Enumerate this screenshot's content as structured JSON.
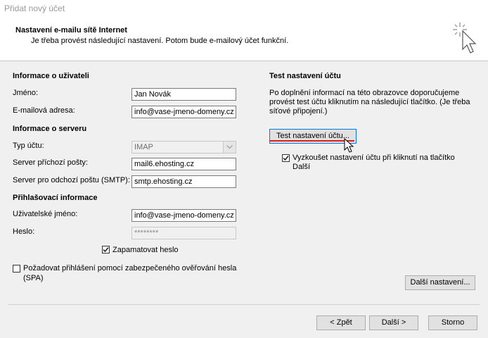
{
  "window": {
    "title": "Přidat nový účet"
  },
  "header": {
    "title": "Nastavení e-mailu sítě Internet",
    "subtitle": "Je třeba provést následující nastavení. Potom bude e-mailový účet funkční.",
    "icon": "cursor-sparkle-icon"
  },
  "user_info": {
    "section_title": "Informace o uživateli",
    "name_label": "Jméno:",
    "name_value": "Jan Novák",
    "email_label": "E-mailová adresa:",
    "email_value": "info@vase-jmeno-domeny.cz"
  },
  "server_info": {
    "section_title": "Informace o serveru",
    "account_type_label": "Typ účtu:",
    "account_type_value": "IMAP",
    "incoming_label": "Server příchozí pošty:",
    "incoming_value": "mail6.ehosting.cz",
    "outgoing_label": "Server pro odchozí poštu (SMTP):",
    "outgoing_value": "smtp.ehosting.cz"
  },
  "login_info": {
    "section_title": "Přihlašovací informace",
    "username_label": "Uživatelské jméno:",
    "username_value": "info@vase-jmeno-domeny.cz",
    "password_label": "Heslo:",
    "password_value": "********",
    "remember_label": "Zapamatovat heslo",
    "remember_checked": true,
    "spa_label_line1": "Požadovat přihlášení pomocí zabezpečeného ověřování hesla",
    "spa_label_line2": "(SPA)",
    "spa_checked": false
  },
  "test": {
    "section_title": "Test nastavení účtu",
    "desc_line1": "Po doplnění informací na této obrazovce doporučujeme",
    "desc_line2": "provést test účtu kliknutím na následující tlačítko. (Je třeba",
    "desc_line3": "síťové připojení.)",
    "button_label": "Test nastavení účtu...",
    "auto_test_line1": "Vyzkoušet nastavení účtu při kliknutí na tlačítko",
    "auto_test_line2": "Další",
    "auto_test_checked": true,
    "highlight_color": "#e21c1c"
  },
  "more_settings_label": "Další nastavení...",
  "footer": {
    "back_label": "< Zpět",
    "next_label": "Další >",
    "cancel_label": "Storno"
  }
}
